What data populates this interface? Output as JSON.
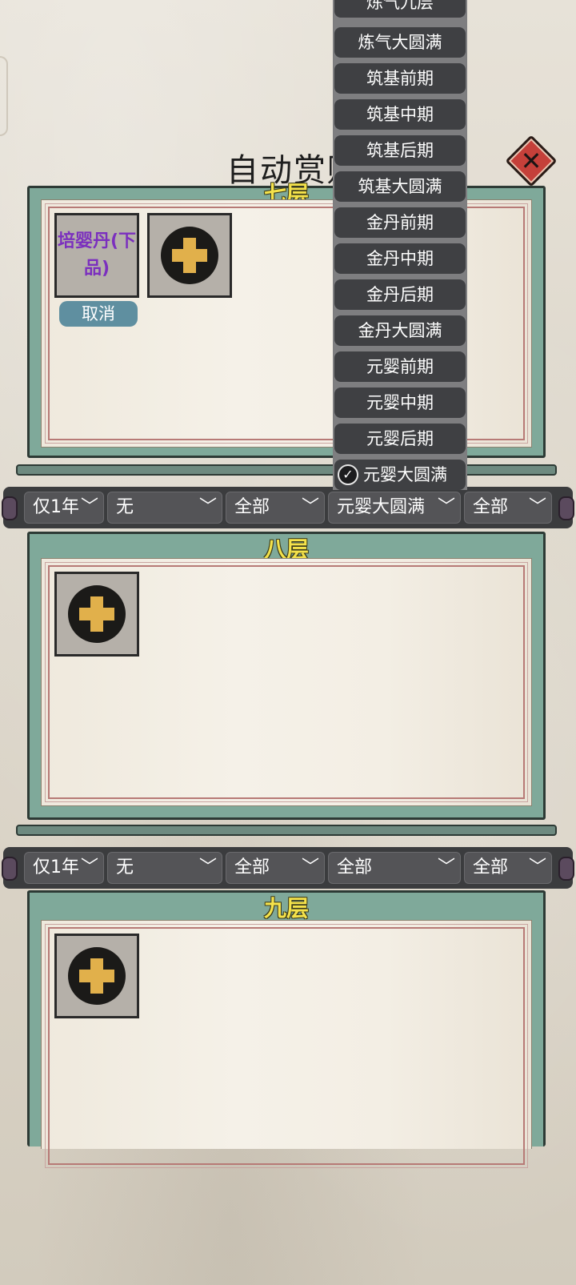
{
  "header": {
    "title": "自动赏赐"
  },
  "panels": [
    {
      "label": "七层",
      "items": [
        {
          "name": "培婴丹(下品)",
          "action": "取消"
        }
      ]
    },
    {
      "label": "八层"
    },
    {
      "label": "九层"
    }
  ],
  "filters": [
    {
      "duration": "仅1年",
      "first": "无",
      "second": "全部",
      "realm": "元婴大圆满",
      "last": "全部"
    },
    {
      "duration": "仅1年",
      "first": "无",
      "second": "全部",
      "realm": "全部",
      "last": "全部"
    }
  ],
  "dropdown": {
    "options": [
      "炼气九层",
      "炼气大圆满",
      "筑基前期",
      "筑基中期",
      "筑基后期",
      "筑基大圆满",
      "金丹前期",
      "金丹中期",
      "金丹后期",
      "金丹大圆满",
      "元婴前期",
      "元婴中期",
      "元婴后期",
      "元婴大圆满"
    ],
    "selected": "元婴大圆满"
  },
  "icons": {
    "close": "close-icon",
    "add": "plus-icon",
    "check": "checkmark-icon",
    "chevron": "chevron-down-icon"
  },
  "colors": {
    "panel": "#7fa99a",
    "label": "#f4e24b",
    "itemText": "#7b2fbe",
    "close": "#c5403a"
  }
}
